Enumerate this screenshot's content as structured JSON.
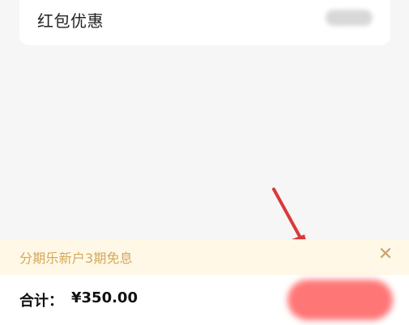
{
  "card": {
    "label": "红包优惠"
  },
  "promo": {
    "text": "分期乐新户3期免息",
    "close_glyph": "✕"
  },
  "bottom": {
    "total_label": "合计：",
    "total_value": "¥350.00"
  },
  "colors": {
    "promo_bg": "#fff8e6",
    "promo_text": "#d4a85a",
    "submit_bg": "#ff6b6b",
    "arrow": "#d93a3a"
  }
}
